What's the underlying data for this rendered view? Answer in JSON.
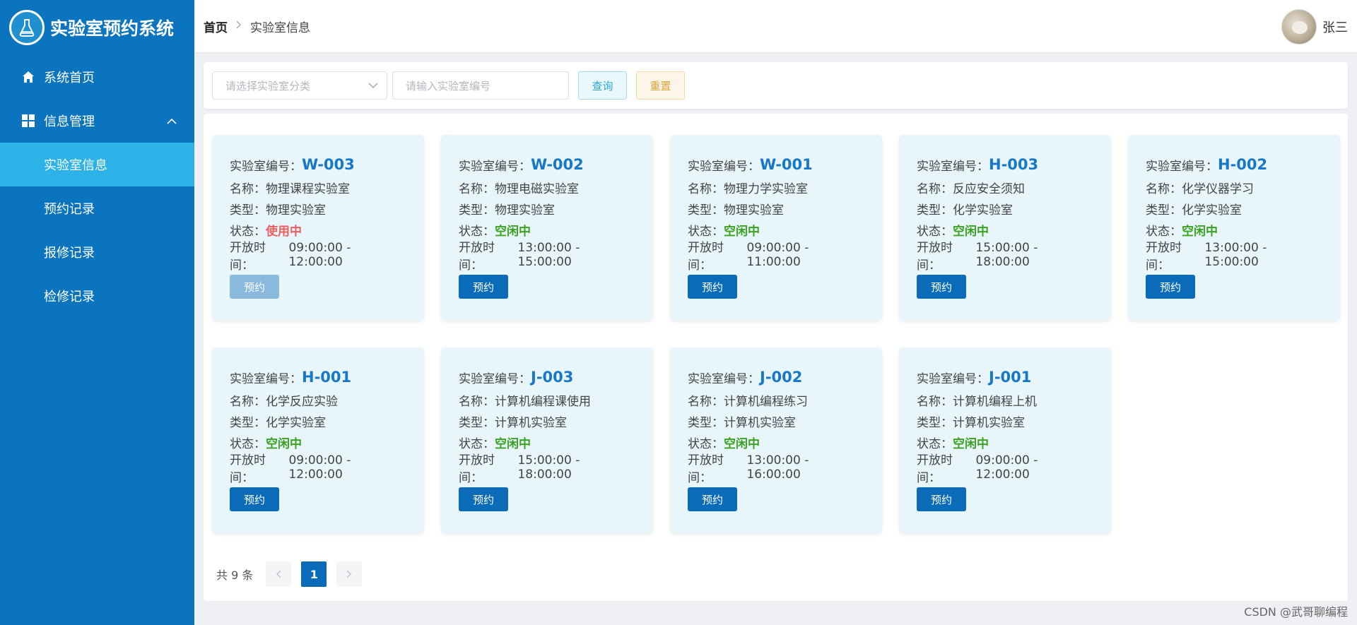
{
  "brand": {
    "title": "实验室预约系统",
    "logo_icon": "flask-icon"
  },
  "sidebar": {
    "home": {
      "label": "系统首页",
      "icon": "home-icon"
    },
    "group": {
      "label": "信息管理",
      "icon": "grid-icon"
    },
    "sub_items": [
      {
        "label": "实验室信息",
        "active": true
      },
      {
        "label": "预约记录"
      },
      {
        "label": "报修记录"
      },
      {
        "label": "检修记录"
      }
    ]
  },
  "header": {
    "breadcrumb_home": "首页",
    "breadcrumb_current": "实验室信息",
    "user_name": "张三"
  },
  "filter": {
    "category_placeholder": "请选择实验室分类",
    "code_placeholder": "请输入实验室编号",
    "query_label": "查询",
    "reset_label": "重置"
  },
  "labels": {
    "code": "实验室编号：",
    "name": "名称：",
    "type": "类型：",
    "status": "状态：",
    "time": "开放时间：",
    "book": "预约"
  },
  "labs": [
    {
      "code": "W-003",
      "name": "物理课程实验室",
      "type": "物理实验室",
      "status": "使用中",
      "time": "09:00:00 - 12:00:00"
    },
    {
      "code": "W-002",
      "name": "物理电磁实验室",
      "type": "物理实验室",
      "status": "空闲中",
      "time": "13:00:00 - 15:00:00"
    },
    {
      "code": "W-001",
      "name": "物理力学实验室",
      "type": "物理实验室",
      "status": "空闲中",
      "time": "09:00:00 - 11:00:00"
    },
    {
      "code": "H-003",
      "name": "反应安全须知",
      "type": "化学实验室",
      "status": "空闲中",
      "time": "15:00:00 - 18:00:00"
    },
    {
      "code": "H-002",
      "name": "化学仪器学习",
      "type": "化学实验室",
      "status": "空闲中",
      "time": "13:00:00 - 15:00:00"
    },
    {
      "code": "H-001",
      "name": "化学反应实验",
      "type": "化学实验室",
      "status": "空闲中",
      "time": "09:00:00 - 12:00:00"
    },
    {
      "code": "J-003",
      "name": "计算机编程课使用",
      "type": "计算机实验室",
      "status": "空闲中",
      "time": "15:00:00 - 18:00:00"
    },
    {
      "code": "J-002",
      "name": "计算机编程练习",
      "type": "计算机实验室",
      "status": "空闲中",
      "time": "13:00:00 - 16:00:00"
    },
    {
      "code": "J-001",
      "name": "计算机编程上机",
      "type": "计算机实验室",
      "status": "空闲中",
      "time": "09:00:00 - 12:00:00"
    }
  ],
  "pagination": {
    "total_text": "共 9 条",
    "current_page": "1"
  },
  "watermark": "CSDN @武哥聊编程",
  "colors": {
    "sidebar": "#0a74be",
    "active": "#2cb2e6",
    "busy": "#ec5e5e",
    "free": "#3aa320",
    "primary": "#0a6bb8"
  }
}
